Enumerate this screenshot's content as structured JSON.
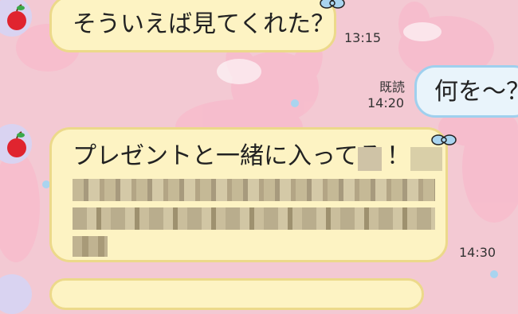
{
  "messages": [
    {
      "side": "left",
      "text": "そういえば見てくれた？",
      "time": "13:15"
    },
    {
      "side": "right",
      "text": "何を～？",
      "read_label": "既読",
      "time": "14:20"
    },
    {
      "side": "left",
      "text": "プレゼントと一緒に入ってる",
      "text_end": "！",
      "time": "14:30"
    }
  ],
  "colors": {
    "background": "#f3c9d3",
    "left_bubble": "#fdf3c3",
    "left_border": "#ecd98a",
    "right_bubble": "#e9f4fb",
    "right_border": "#9fd0ee",
    "avatar_bg": "#d9d3f1"
  },
  "icons": [
    "apple-avatar-icon",
    "bow-icon",
    "bunny-sticker-icon"
  ]
}
